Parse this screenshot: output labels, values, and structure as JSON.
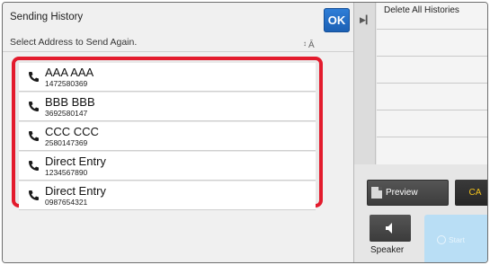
{
  "dialog": {
    "title": "Sending History",
    "ok_label": "OK",
    "subtitle": "Select Address to Send Again.",
    "sort_icon": "sort-az-icon",
    "items": [
      {
        "name": "AAA AAA",
        "number": "1472580369",
        "icon": "phone-icon"
      },
      {
        "name": "BBB BBB",
        "number": "3692580147",
        "icon": "phone-icon"
      },
      {
        "name": "CCC CCC",
        "number": "2580147369",
        "icon": "phone-icon"
      },
      {
        "name": "Direct Entry",
        "number": "1234567890",
        "icon": "phone-icon"
      },
      {
        "name": "Direct Entry",
        "number": "0987654321",
        "icon": "phone-icon"
      }
    ]
  },
  "right_panel": {
    "history_rows": [
      "Delete All Histories",
      "",
      "",
      "",
      "",
      ""
    ],
    "preview_label": "Preview",
    "ca_label": "CA",
    "speaker_label": "Speaker",
    "start_label": "Start"
  },
  "colors": {
    "accent_ok": "#1f66be",
    "highlight_border": "#e31b2d",
    "ca_text": "#f2c21b",
    "start_bg": "#b9def5"
  }
}
